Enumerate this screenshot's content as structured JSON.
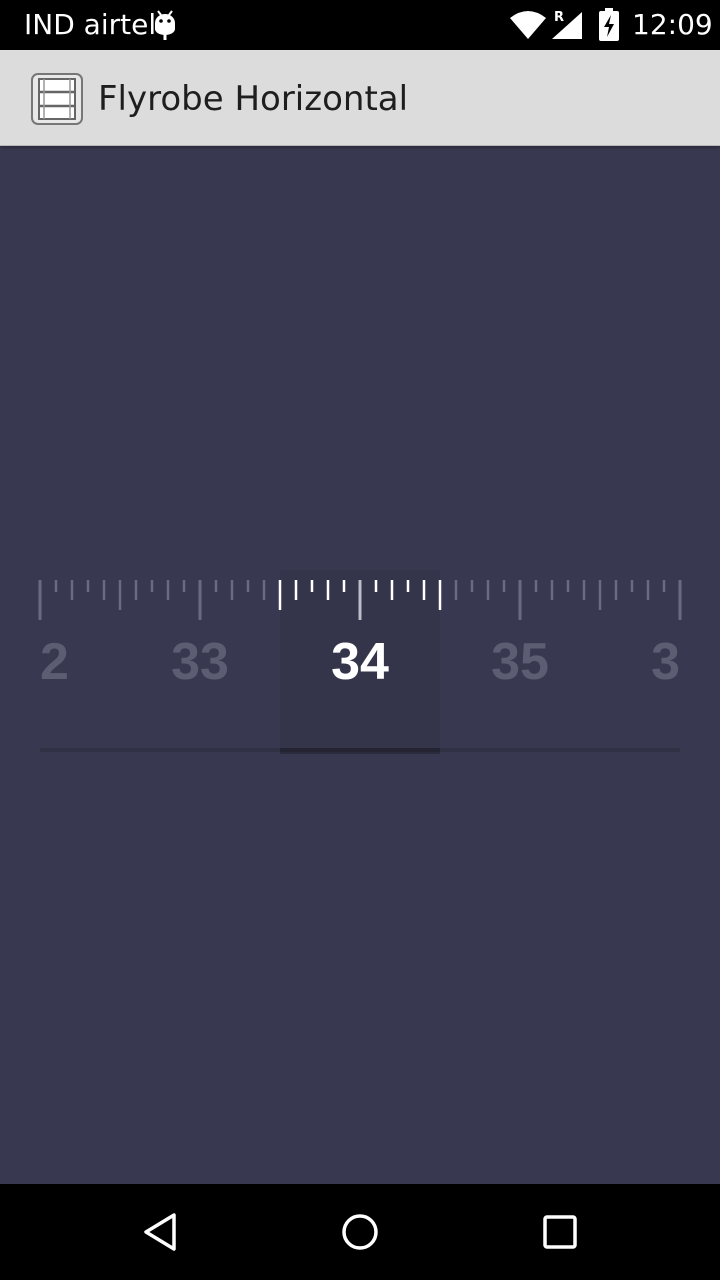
{
  "status_bar": {
    "carrier": "IND airtel",
    "roaming": "R",
    "time": "12:09",
    "icons": [
      "android-debug-icon",
      "wifi-icon",
      "signal-icon",
      "battery-charging-icon"
    ]
  },
  "action_bar": {
    "app_icon": "film-strip-icon",
    "title": "Flyrobe Horizontal"
  },
  "ruler": {
    "selected_value": 34,
    "labels": [
      "2",
      "33",
      "34",
      "35",
      "3"
    ],
    "colors": {
      "background": "#383850",
      "selected": "#ffffff",
      "dim": "#5c5c72"
    }
  },
  "nav_bar": {
    "icons": [
      "back-icon",
      "home-icon",
      "recents-icon"
    ]
  }
}
